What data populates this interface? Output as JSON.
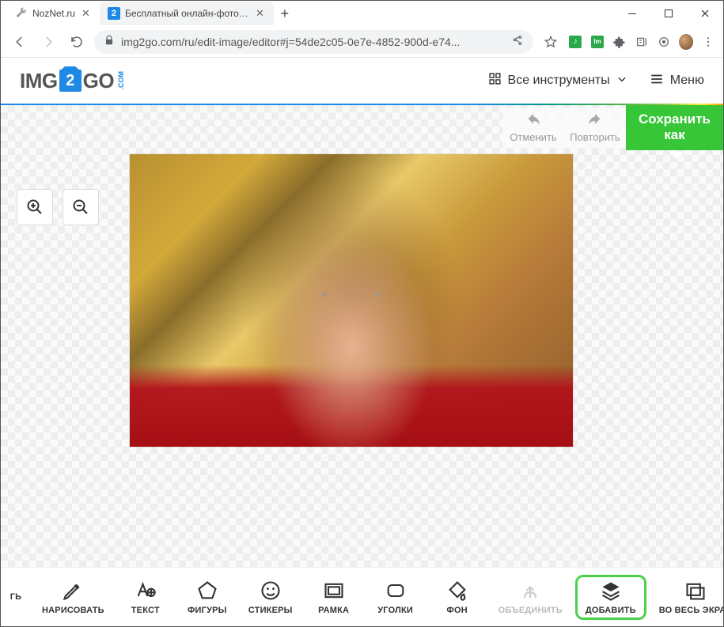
{
  "window": {
    "tabs": [
      {
        "title": "NozNet.ru",
        "active": false
      },
      {
        "title": "Бесплатный онлайн-фоторедак",
        "active": true
      }
    ],
    "url": "img2go.com/ru/edit-image/editor#j=54de2c05-0e7e-4852-900d-e74..."
  },
  "header": {
    "logo_left": "IMG",
    "logo_badge": "2",
    "logo_right": "GO",
    "logo_suffix": ".COM",
    "all_tools": "Все инструменты",
    "menu": "Меню"
  },
  "editor": {
    "undo": "Отменить",
    "redo": "Повторить",
    "save_as_line1": "Сохранить",
    "save_as_line2": "как"
  },
  "toolbar": {
    "items": [
      {
        "id": "crop-partial",
        "label": "ГЬ"
      },
      {
        "id": "draw",
        "label": "НАРИСОВАТЬ"
      },
      {
        "id": "text",
        "label": "ТЕКСТ"
      },
      {
        "id": "shapes",
        "label": "ФИГУРЫ"
      },
      {
        "id": "stickers",
        "label": "СТИКЕРЫ"
      },
      {
        "id": "frame",
        "label": "РАМКА"
      },
      {
        "id": "corners",
        "label": "УГОЛКИ"
      },
      {
        "id": "background",
        "label": "ФОН"
      },
      {
        "id": "merge",
        "label": "ОБЪЕДИНИТЬ",
        "disabled": true
      },
      {
        "id": "add",
        "label": "ДОБАВИТЬ",
        "highlighted": true
      },
      {
        "id": "fullscreen",
        "label": "ВО ВЕСЬ ЭКРАН"
      }
    ]
  },
  "icons": {
    "grid": "grid-icon",
    "chevron_down": "chevron-down-icon",
    "hamburger": "hamburger-icon"
  }
}
